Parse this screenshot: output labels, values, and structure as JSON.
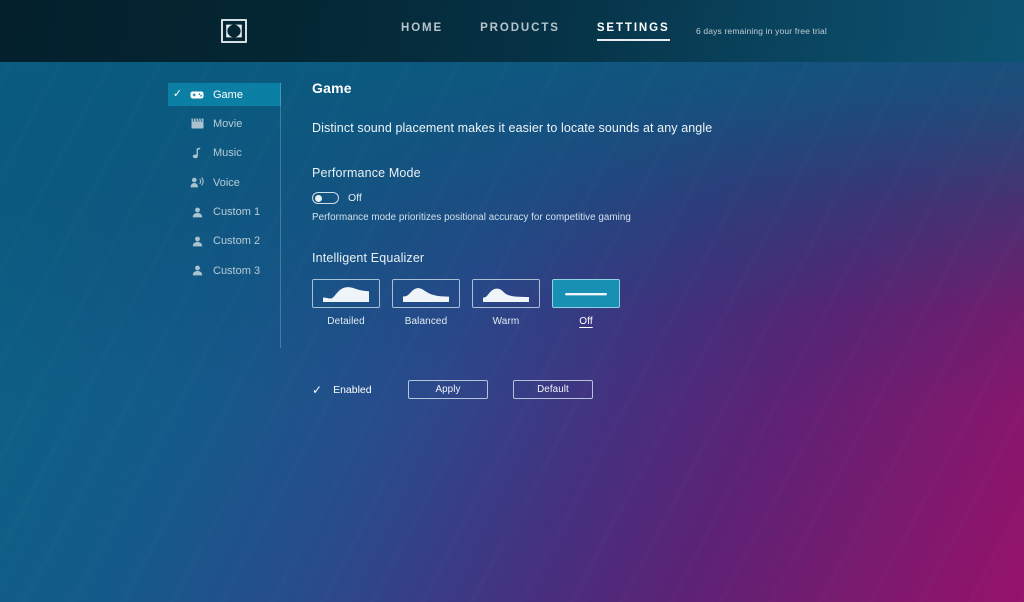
{
  "header": {
    "logo_name": "dolby-logo",
    "nav": [
      {
        "label": "HOME",
        "active": false
      },
      {
        "label": "PRODUCTS",
        "active": false
      },
      {
        "label": "SETTINGS",
        "active": true
      }
    ],
    "trial_notice": "6 days remaining in your free trial"
  },
  "sidebar": {
    "items": [
      {
        "label": "Game",
        "icon": "gamepad-icon",
        "active": true
      },
      {
        "label": "Movie",
        "icon": "clapperboard-icon",
        "active": false
      },
      {
        "label": "Music",
        "icon": "music-note-icon",
        "active": false
      },
      {
        "label": "Voice",
        "icon": "voice-icon",
        "active": false
      },
      {
        "label": "Custom 1",
        "icon": "person-icon",
        "active": false
      },
      {
        "label": "Custom 2",
        "icon": "person-icon",
        "active": false
      },
      {
        "label": "Custom 3",
        "icon": "person-icon",
        "active": false
      }
    ]
  },
  "main": {
    "title": "Game",
    "description": "Distinct sound placement makes it easier to locate sounds at any angle",
    "performance": {
      "title": "Performance Mode",
      "toggle_state": "Off",
      "toggle_on": false,
      "help": "Performance mode prioritizes positional accuracy for competitive gaming"
    },
    "equalizer": {
      "title": "Intelligent Equalizer",
      "presets": [
        {
          "label": "Detailed",
          "curve": "detailed-curve-icon",
          "selected": false
        },
        {
          "label": "Balanced",
          "curve": "balanced-curve-icon",
          "selected": false
        },
        {
          "label": "Warm",
          "curve": "warm-curve-icon",
          "selected": false
        },
        {
          "label": "Off",
          "curve": "flat-line-icon",
          "selected": true
        }
      ]
    },
    "actions": {
      "enabled_label": "Enabled",
      "enabled_checked": true,
      "apply_label": "Apply",
      "default_label": "Default"
    }
  },
  "colors": {
    "accent_teal": "#0b7fa4",
    "selected_card": "#1790b4",
    "header_dark": "#03202c",
    "text_primary": "#ffffff",
    "text_muted": "#b7ccd6"
  }
}
